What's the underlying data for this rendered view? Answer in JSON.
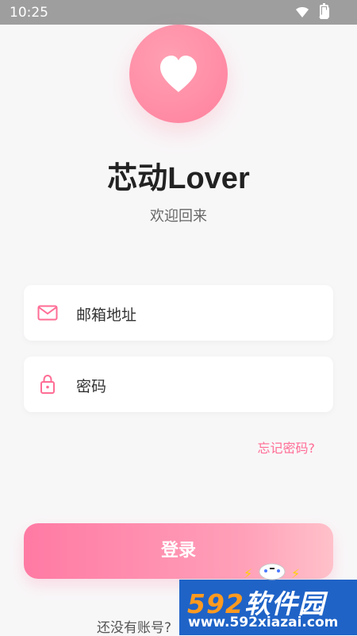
{
  "status_bar": {
    "time": "10:25",
    "icons": [
      "wifi-icon",
      "signal-icon",
      "battery-icon"
    ]
  },
  "app": {
    "title": "芯动Lover",
    "subtitle": "欢迎回来",
    "accent_color": "#ff7f9b",
    "background_color": "#f8f7f8"
  },
  "form": {
    "email_placeholder": "邮箱地址",
    "password_placeholder": "密码",
    "forgot_password": "忘记密码?",
    "login_button": "登录",
    "signup_prompt": "还没有账号?"
  },
  "watermark": {
    "brand_number": "592",
    "brand_text": "软件园",
    "url": "www.592xiazai.com"
  }
}
